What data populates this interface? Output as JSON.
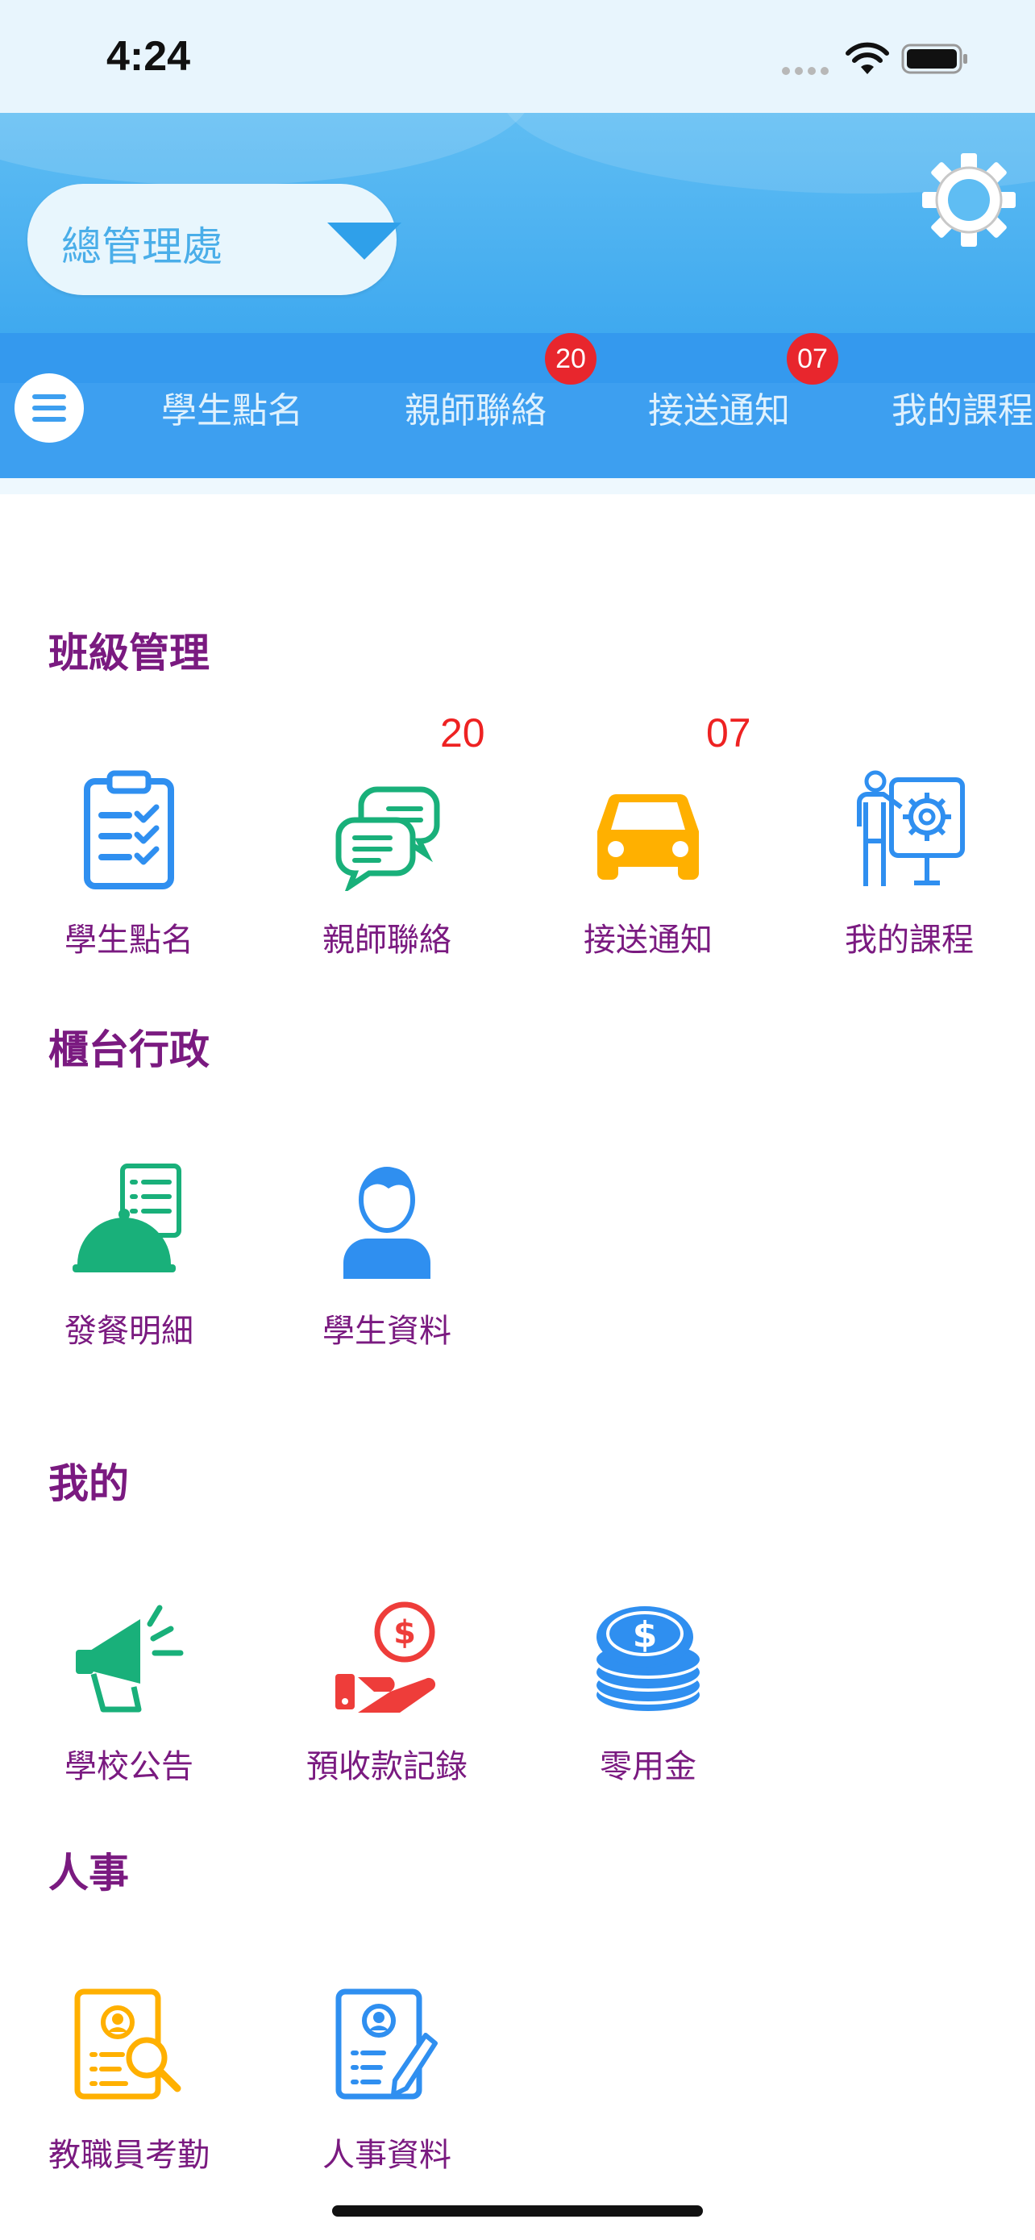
{
  "status_bar": {
    "time": "4:24"
  },
  "header": {
    "department": "總管理處"
  },
  "tabs": [
    {
      "label": "學生點名",
      "badge": ""
    },
    {
      "label": "親師聯絡",
      "badge": "20"
    },
    {
      "label": "接送通知",
      "badge": "07"
    },
    {
      "label": "我的課程",
      "badge": ""
    }
  ],
  "sections": {
    "class_mgmt": {
      "title": "班級管理",
      "items": [
        {
          "label": "學生點名",
          "icon": "clipboard-checklist-icon",
          "count": ""
        },
        {
          "label": "親師聯絡",
          "icon": "chat-bubbles-icon",
          "count": "20"
        },
        {
          "label": "接送通知",
          "icon": "car-icon",
          "count": "07"
        },
        {
          "label": "我的課程",
          "icon": "teacher-board-icon",
          "count": ""
        }
      ]
    },
    "front_desk": {
      "title": "櫃台行政",
      "items": [
        {
          "label": "發餐明細",
          "icon": "meal-cloche-icon"
        },
        {
          "label": "學生資料",
          "icon": "student-person-icon"
        }
      ]
    },
    "mine": {
      "title": "我的",
      "items": [
        {
          "label": "學校公告",
          "icon": "megaphone-icon"
        },
        {
          "label": "預收款記錄",
          "icon": "hand-money-icon"
        },
        {
          "label": "零用金",
          "icon": "coins-stack-icon"
        }
      ]
    },
    "hr": {
      "title": "人事",
      "items": [
        {
          "label": "教職員考勤",
          "icon": "profile-search-icon"
        },
        {
          "label": "人事資料",
          "icon": "profile-edit-icon"
        }
      ]
    }
  },
  "colors": {
    "accent_blue": "#3d9ff0",
    "label_purple": "#7a1a80",
    "badge_red": "#e8262d",
    "icon_blue": "#2f8ff0",
    "icon_green": "#19b07a",
    "icon_orange": "#ffb000",
    "icon_red": "#ee3d3a"
  }
}
